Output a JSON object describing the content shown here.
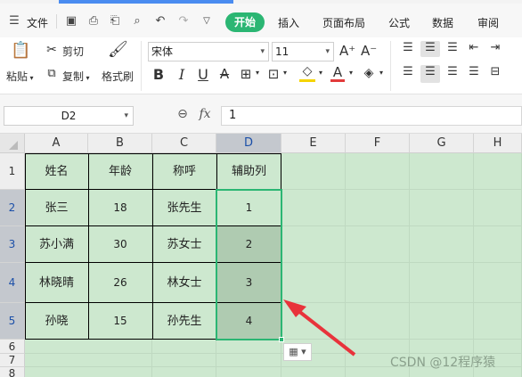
{
  "menubar": {
    "file_label": "文件",
    "tabs": [
      {
        "label": "开始",
        "active": true
      },
      {
        "label": "插入"
      },
      {
        "label": "页面布局"
      },
      {
        "label": "公式"
      },
      {
        "label": "数据"
      },
      {
        "label": "审阅"
      }
    ]
  },
  "ribbon": {
    "paste_label": "粘贴",
    "cut_label": "剪切",
    "copy_label": "复制",
    "format_painter_label": "格式刷",
    "font_name": "宋体",
    "font_size": "11"
  },
  "formula_bar": {
    "name_box": "D2",
    "fx_label": "fx",
    "formula": "1"
  },
  "sheet": {
    "columns": [
      "A",
      "B",
      "C",
      "D",
      "E",
      "F",
      "G",
      "H"
    ],
    "selected_column": "D",
    "rows": [
      "1",
      "2",
      "3",
      "4",
      "5",
      "6",
      "7",
      "8"
    ],
    "selected_rows": [
      "2",
      "3",
      "4",
      "5"
    ],
    "header": [
      "姓名",
      "年龄",
      "称呼",
      "辅助列"
    ],
    "data": [
      [
        "张三",
        "18",
        "张先生",
        "1"
      ],
      [
        "苏小满",
        "30",
        "苏女士",
        "2"
      ],
      [
        "林晓晴",
        "26",
        "林女士",
        "3"
      ],
      [
        "孙晓",
        "15",
        "孙先生",
        "4"
      ]
    ],
    "active_cell": "D2"
  },
  "colors": {
    "accent_green": "#2bb673",
    "sheet_bg": "#cde8cf",
    "annotation_red": "#e8333b"
  },
  "watermark": "CSDN @12程序猿"
}
